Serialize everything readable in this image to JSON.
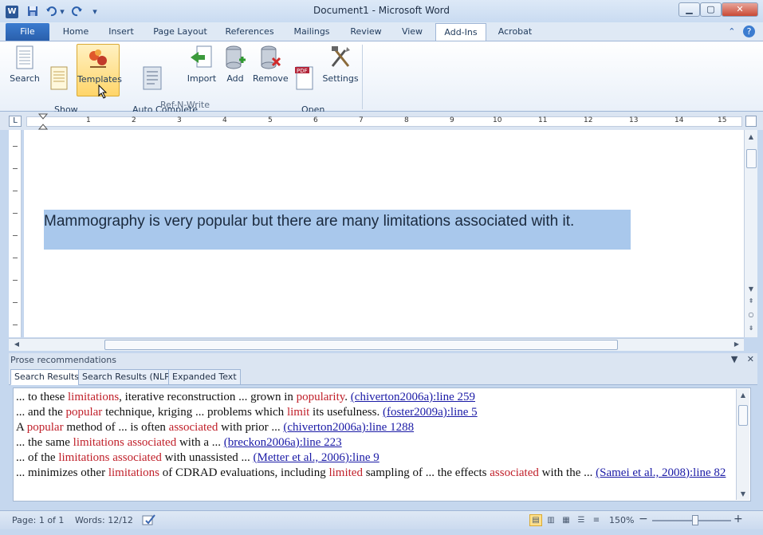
{
  "titlebar": {
    "app_icon": "W",
    "title": "Document1  -  Microsoft Word",
    "minimize": "▁",
    "maximize": "▢",
    "close": "✕"
  },
  "qat": {
    "save_icon": "save-icon",
    "undo_icon": "undo-icon",
    "redo_icon": "redo-icon",
    "customize_icon": "customize-icon"
  },
  "tabs": {
    "file": "File",
    "items": [
      "Home",
      "Insert",
      "Page Layout",
      "References",
      "Mailings",
      "Review",
      "View",
      "Add-Ins",
      "Acrobat"
    ],
    "active": "Add-Ins"
  },
  "ribbon": {
    "buttons": [
      {
        "label": "Search",
        "icon": "search-doc-icon"
      },
      {
        "label": "Show\nSimilar",
        "icon": "show-similar-icon"
      },
      {
        "label": "Templates",
        "icon": "templates-icon"
      },
      {
        "label": "Auto Complete\n(OFF)",
        "icon": "auto-complete-icon"
      },
      {
        "label": "Import",
        "icon": "import-icon"
      },
      {
        "label": "Add",
        "icon": "add-database-icon"
      },
      {
        "label": "Remove",
        "icon": "remove-database-icon"
      },
      {
        "label": "Open\nPDF",
        "icon": "pdf-icon"
      },
      {
        "label": "Settings",
        "icon": "settings-tools-icon"
      }
    ],
    "group_label": "Ref-N-Write",
    "pdf_badge": "PDF"
  },
  "ruler": {
    "numbers": [
      "1",
      "2",
      "3",
      "4",
      "5",
      "6",
      "7",
      "8",
      "9",
      "10",
      "11",
      "12",
      "13",
      "14",
      "15"
    ],
    "tab_stop": "L"
  },
  "document": {
    "text": "Mammography is very popular but there are many limitations associated with it."
  },
  "pane": {
    "title": "Prose recommendations",
    "tabs": [
      "Search Results",
      "Search Results (NLP)",
      "Expanded Text"
    ],
    "active_tab": "Search Results"
  },
  "results": [
    [
      {
        "t": "... to these "
      },
      {
        "t": "limitations",
        "k": 1
      },
      {
        "t": ", iterative reconstruction ... grown in "
      },
      {
        "t": "popularity",
        "k": 1
      },
      {
        "t": ".  "
      },
      {
        "t": "(chiverton2006a):line 259",
        "r": 1
      }
    ],
    [
      {
        "t": "... and the "
      },
      {
        "t": "popular",
        "k": 1
      },
      {
        "t": " technique, kriging ... problems which "
      },
      {
        "t": "limit",
        "k": 1
      },
      {
        "t": " its usefulness.  "
      },
      {
        "t": "(foster2009a):line 5",
        "r": 1
      }
    ],
    [
      {
        "t": "A "
      },
      {
        "t": "popular",
        "k": 1
      },
      {
        "t": " method of ... is often "
      },
      {
        "t": "associated",
        "k": 1
      },
      {
        "t": " with prior ...  "
      },
      {
        "t": "(chiverton2006a):line 1288",
        "r": 1
      }
    ],
    [
      {
        "t": "... the same "
      },
      {
        "t": "limitations associated",
        "k": 1
      },
      {
        "t": " with a ...  "
      },
      {
        "t": "(breckon2006a):line 223",
        "r": 1
      }
    ],
    [
      {
        "t": "... of the "
      },
      {
        "t": "limitations associated",
        "k": 1
      },
      {
        "t": " with unassisted ...  "
      },
      {
        "t": "(Metter et al., 2006):line 9",
        "r": 1
      }
    ],
    [
      {
        "t": "... minimizes other "
      },
      {
        "t": "limitations",
        "k": 1
      },
      {
        "t": " of CDRAD evaluations, including "
      },
      {
        "t": "limited",
        "k": 1
      },
      {
        "t": " sampling of ... the effects "
      },
      {
        "t": "associated",
        "k": 1
      },
      {
        "t": " with the ...  "
      },
      {
        "t": "(Samei et al., 2008):line 82",
        "r": 1
      }
    ]
  ],
  "statusbar": {
    "page": "Page: 1 of 1",
    "words": "Words: 12/12",
    "zoom": "150%",
    "zoom_level": 0.55,
    "zoom_out": "−",
    "zoom_in": "+"
  }
}
